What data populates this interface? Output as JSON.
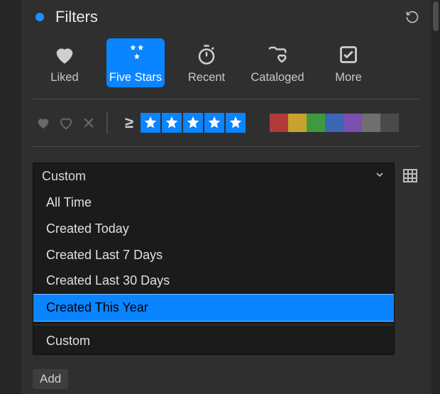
{
  "header": {
    "title": "Filters"
  },
  "presets": [
    {
      "id": "liked",
      "label": "Liked"
    },
    {
      "id": "five-stars",
      "label": "Five Stars",
      "active": true
    },
    {
      "id": "recent",
      "label": "Recent"
    },
    {
      "id": "cataloged",
      "label": "Cataloged"
    },
    {
      "id": "more",
      "label": "More"
    }
  ],
  "rating": {
    "comparator": "≥",
    "stars": 5
  },
  "color_labels": [
    "#b23a3a",
    "#c7a22c",
    "#3f9a3f",
    "#3a66b2",
    "#7a4fb0",
    "#6f6f6f",
    "#4a4a4a"
  ],
  "date_filter": {
    "selected": "Custom",
    "options": [
      "All Time",
      "Created Today",
      "Created Last 7 Days",
      "Created Last 30 Days",
      "Created This Year"
    ],
    "highlighted": "Created This Year",
    "footer_option": "Custom"
  },
  "add_button": "Add"
}
